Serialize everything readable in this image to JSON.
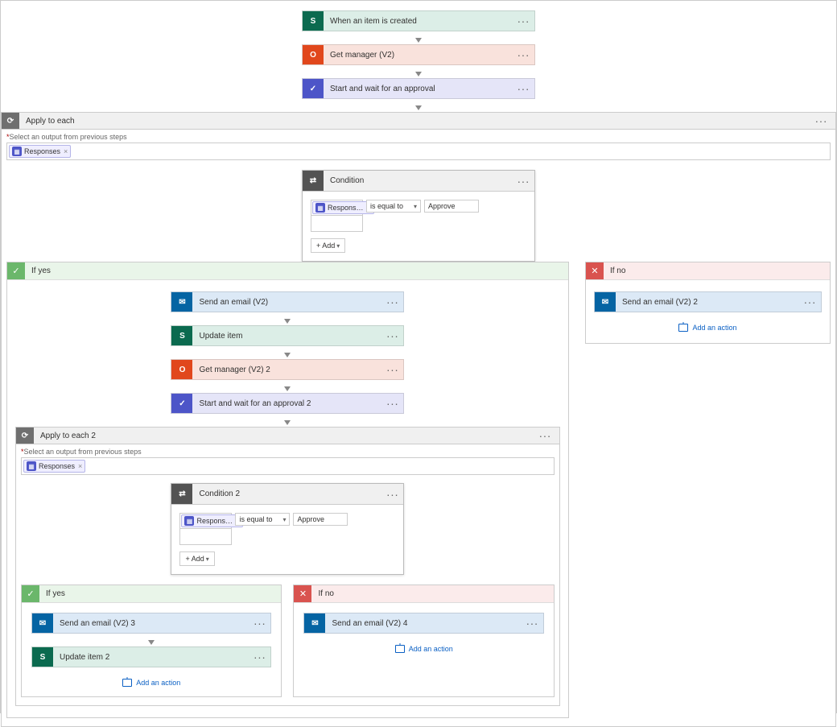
{
  "steps": {
    "s1": "When an item is created",
    "s2": "Get manager (V2)",
    "s3": "Start and wait for an approval"
  },
  "applyEach": {
    "title": "Apply to each",
    "helper": "Select an output from previous steps",
    "token": "Responses"
  },
  "condition": {
    "title": "Condition",
    "token": "Respons…",
    "op": "is equal to",
    "value": "Approve",
    "addBtn": "Add"
  },
  "yes": {
    "title": "If yes",
    "steps": {
      "email": "Send an email (V2)",
      "update": "Update item",
      "manager": "Get manager (V2) 2",
      "approval": "Start and wait for an approval 2"
    }
  },
  "no": {
    "title": "If no",
    "email": "Send an email (V2) 2",
    "addAction": "Add an action"
  },
  "applyEach2": {
    "title": "Apply to each 2",
    "helper": "Select an output from previous steps",
    "token": "Responses"
  },
  "condition2": {
    "title": "Condition 2",
    "token": "Respons…",
    "op": "is equal to",
    "value": "Approve",
    "addBtn": "Add"
  },
  "inner": {
    "yes": {
      "title": "If yes",
      "email": "Send an email (V2) 3",
      "update": "Update item 2",
      "addAction": "Add an action"
    },
    "no": {
      "title": "If no",
      "email": "Send an email (V2) 4",
      "addAction": "Add an action"
    }
  }
}
